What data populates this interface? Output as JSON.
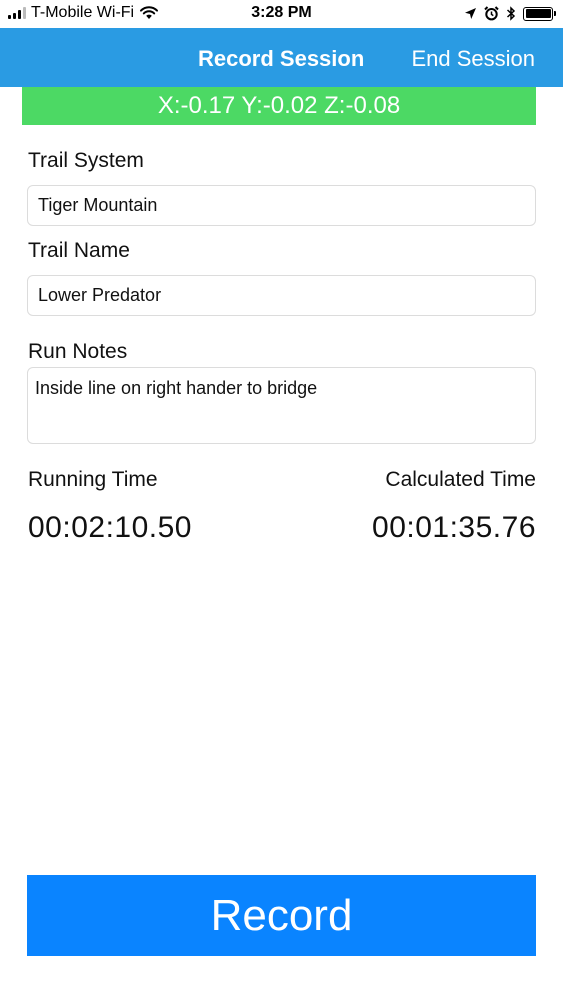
{
  "status_bar": {
    "carrier": "T-Mobile Wi-Fi",
    "time": "3:28 PM",
    "icons": [
      "signal-bars-icon",
      "wifi-icon",
      "location-arrow-icon",
      "alarm-clock-icon",
      "bluetooth-icon",
      "battery-icon"
    ],
    "battery_level": 1.0
  },
  "nav_bar": {
    "title": "Record Session",
    "end_session_label": "End Session",
    "background_color": "#2a9be3"
  },
  "accelerometer": {
    "readout": "X:-0.17 Y:-0.02 Z:-0.08",
    "background_color": "#4cd964"
  },
  "form": {
    "trail_system": {
      "label": "Trail System",
      "value": "Tiger Mountain"
    },
    "trail_name": {
      "label": "Trail Name",
      "value": "Lower Predator"
    },
    "run_notes": {
      "label": "Run Notes",
      "value": "Inside line on right hander to bridge"
    }
  },
  "timers": {
    "running": {
      "label": "Running Time",
      "value": "00:02:10.50"
    },
    "calculated": {
      "label": "Calculated Time",
      "value": "00:01:35.76"
    }
  },
  "record_button": {
    "label": "Record",
    "background_color": "#0a84ff"
  }
}
